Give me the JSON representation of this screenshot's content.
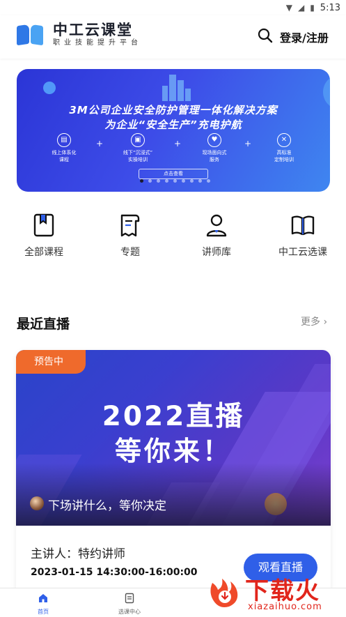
{
  "status_bar": {
    "time": "5:13"
  },
  "header": {
    "app_title": "中工云课堂",
    "app_subtitle": "职业技能提升平台",
    "login_label": "登录/注册"
  },
  "banner": {
    "title_line1": "3M公司企业安全防护管理一体化解决方案",
    "title_line2": "为企业“安全生产”充电护航",
    "features": [
      {
        "label": "线上体系化\n课程"
      },
      {
        "label": "线下“沉浸式”\n实操培训"
      },
      {
        "label": "现场面向式\n服务"
      },
      {
        "label": "高标准\n定制培训"
      }
    ],
    "cta": "点击查看",
    "slide_count": 9,
    "active_slide": 1
  },
  "quick_nav": [
    {
      "label": "全部课程",
      "icon": "bookmark-book-icon"
    },
    {
      "label": "专题",
      "icon": "scroll-document-icon"
    },
    {
      "label": "讲师库",
      "icon": "teacher-person-icon"
    },
    {
      "label": "中工云选课",
      "icon": "open-book-icon"
    }
  ],
  "recent_live": {
    "title": "最近直播",
    "more_label": "更多",
    "card": {
      "badge": "预告中",
      "headline1": "2022直播",
      "headline2": "等你来！",
      "subtitle": "下场讲什么，等你决定",
      "speaker": "主讲人：特约讲师",
      "time": "2023-01-15 14:30:00-16:00:00",
      "button": "观看直播"
    }
  },
  "tab_bar": [
    {
      "label": "首页",
      "icon": "home-icon",
      "active": true
    },
    {
      "label": "选课中心",
      "icon": "course-center-icon",
      "active": false
    }
  ],
  "watermark": {
    "brand": "下载火",
    "url": "xiazaihuo.com"
  },
  "colors": {
    "primary": "#2f5fe8",
    "badge": "#ef6a2c",
    "watermark": "#e1251b"
  }
}
